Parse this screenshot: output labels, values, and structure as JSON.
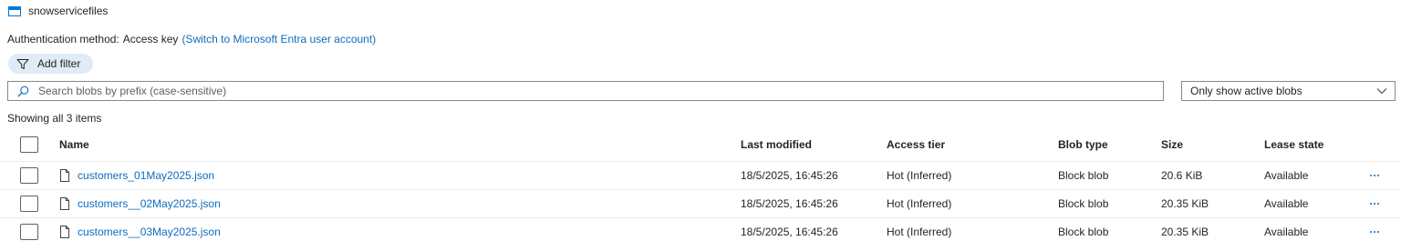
{
  "container": {
    "name": "snowservicefiles"
  },
  "auth": {
    "label": "Authentication method:",
    "value": "Access key",
    "switch_link": "(Switch to Microsoft Entra user account)"
  },
  "filter": {
    "add_filter_label": "Add filter"
  },
  "search": {
    "placeholder": "Search blobs by prefix (case-sensitive)",
    "value": ""
  },
  "blob_state_dropdown": {
    "selected": "Only show active blobs"
  },
  "count_text": "Showing all 3 items",
  "table": {
    "columns": {
      "name": "Name",
      "last_modified": "Last modified",
      "access_tier": "Access tier",
      "blob_type": "Blob type",
      "size": "Size",
      "lease_state": "Lease state"
    },
    "rows": [
      {
        "name": "customers_01May2025.json",
        "last_modified": "18/5/2025, 16:45:26",
        "access_tier": "Hot (Inferred)",
        "blob_type": "Block blob",
        "size": "20.6 KiB",
        "lease_state": "Available"
      },
      {
        "name": "customers__02May2025.json",
        "last_modified": "18/5/2025, 16:45:26",
        "access_tier": "Hot (Inferred)",
        "blob_type": "Block blob",
        "size": "20.35 KiB",
        "lease_state": "Available"
      },
      {
        "name": "customers__03May2025.json",
        "last_modified": "18/5/2025, 16:45:26",
        "access_tier": "Hot (Inferred)",
        "blob_type": "Block blob",
        "size": "20.35 KiB",
        "lease_state": "Available"
      }
    ]
  },
  "icons": {
    "container": "storage-container-icon",
    "filter": "funnel-icon",
    "search": "search-icon",
    "dropdown": "chevron-down-icon",
    "file": "document-icon",
    "more": "more-ellipsis-icon"
  },
  "colors": {
    "accent": "#0078d4",
    "link": "#0f6cbd",
    "filter_pill_bg": "#e0ebf7",
    "border": "#8a8886",
    "row_divider": "#ececec"
  }
}
